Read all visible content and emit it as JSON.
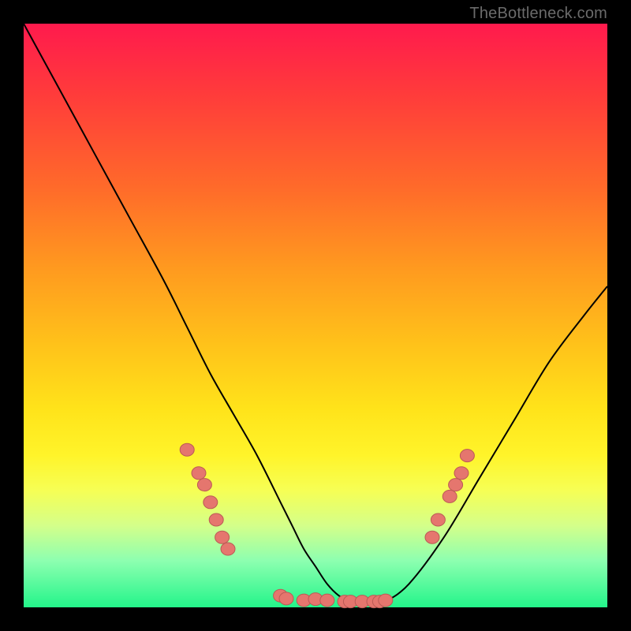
{
  "watermark": "TheBottleneck.com",
  "colors": {
    "curve_stroke": "#000000",
    "marker_fill": "#e5766e",
    "marker_stroke": "#bb5a55",
    "bg_black": "#000000"
  },
  "chart_data": {
    "type": "line",
    "title": "",
    "xlabel": "",
    "ylabel": "",
    "xlim": [
      0,
      100
    ],
    "ylim": [
      0,
      100
    ],
    "grid": false,
    "series": [
      {
        "name": "curve",
        "x": [
          0,
          6,
          12,
          18,
          24,
          28,
          32,
          36,
          40,
          44,
          46,
          48,
          50,
          52,
          54,
          56,
          58,
          60,
          62,
          66,
          72,
          78,
          84,
          90,
          96,
          100
        ],
        "y": [
          100,
          89,
          78,
          67,
          56,
          48,
          40,
          33,
          26,
          18,
          14,
          10,
          7,
          4,
          2,
          1,
          0.5,
          0.5,
          1,
          4,
          12,
          22,
          32,
          42,
          50,
          55
        ]
      }
    ],
    "markers": [
      {
        "x": 28,
        "y": 27
      },
      {
        "x": 30,
        "y": 23
      },
      {
        "x": 31,
        "y": 21
      },
      {
        "x": 32,
        "y": 18
      },
      {
        "x": 33,
        "y": 15
      },
      {
        "x": 34,
        "y": 12
      },
      {
        "x": 35,
        "y": 10
      },
      {
        "x": 44,
        "y": 2
      },
      {
        "x": 45,
        "y": 1.5
      },
      {
        "x": 48,
        "y": 1.2
      },
      {
        "x": 50,
        "y": 1.4
      },
      {
        "x": 52,
        "y": 1.2
      },
      {
        "x": 55,
        "y": 1.0
      },
      {
        "x": 56,
        "y": 1.0
      },
      {
        "x": 58,
        "y": 1.0
      },
      {
        "x": 60,
        "y": 1.0
      },
      {
        "x": 61,
        "y": 1.0
      },
      {
        "x": 62,
        "y": 1.2
      },
      {
        "x": 70,
        "y": 12
      },
      {
        "x": 71,
        "y": 15
      },
      {
        "x": 73,
        "y": 19
      },
      {
        "x": 74,
        "y": 21
      },
      {
        "x": 75,
        "y": 23
      },
      {
        "x": 76,
        "y": 26
      }
    ]
  }
}
